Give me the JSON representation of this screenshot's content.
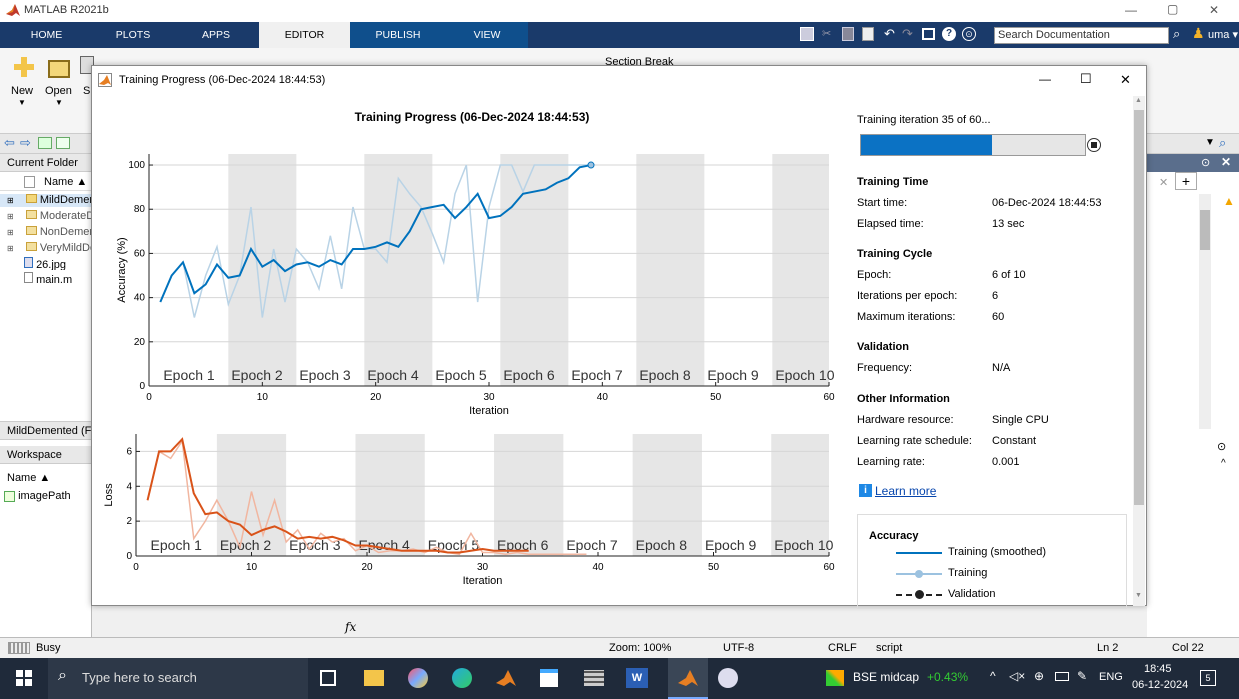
{
  "window": {
    "title": "MATLAB R2021b",
    "min": "—",
    "max": "▢",
    "close": "✕"
  },
  "tabs": [
    "HOME",
    "PLOTS",
    "APPS",
    "EDITOR",
    "PUBLISH",
    "VIEW"
  ],
  "active_tab": "EDITOR",
  "search": {
    "placeholder": "Search Documentation"
  },
  "user": "uma ▾",
  "toolstrip": {
    "new": "New",
    "open": "Open",
    "s": "S",
    "section_break": "Section Break"
  },
  "current_folder": {
    "title": "Current Folder",
    "col": "Name ▲",
    "items": [
      {
        "name": "MildDemented",
        "type": "folder",
        "sel": true
      },
      {
        "name": "ModerateDemented",
        "type": "folder"
      },
      {
        "name": "NonDemented",
        "type": "folder"
      },
      {
        "name": "VeryMildDemented",
        "type": "folder"
      },
      {
        "name": "26.jpg",
        "type": "img"
      },
      {
        "name": "main.m",
        "type": "m"
      }
    ],
    "details": "MildDemented (F"
  },
  "workspace": {
    "title": "Workspace",
    "col": "Name ▲",
    "items": [
      "imagePath"
    ]
  },
  "status": {
    "busy": "Busy",
    "zoom": "Zoom: 100%",
    "enc": "UTF-8",
    "eol": "CRLF",
    "type": "script",
    "ln": "Ln  2",
    "col": "Col  22"
  },
  "command": {
    "fx": "fx"
  },
  "taskbar": {
    "search": "Type here to search",
    "ticker": "BSE midcap",
    "change": "+0.43%",
    "lang": "ENG",
    "time": "18:45",
    "date": "06-12-2024",
    "notif": "5"
  },
  "dialog": {
    "title": "Training Progress (06-Dec-2024 18:44:53)",
    "plot_title": "Training Progress (06-Dec-2024 18:44:53)",
    "min": "—",
    "max": "☐",
    "close": "✕"
  },
  "side": {
    "iteration_text": "Training iteration 35 of 60...",
    "progress": 0.583,
    "training_time": {
      "header": "Training Time",
      "start_label": "Start time:",
      "start": "06-Dec-2024 18:44:53",
      "elapsed_label": "Elapsed time:",
      "elapsed": "13 sec"
    },
    "training_cycle": {
      "header": "Training Cycle",
      "epoch_label": "Epoch:",
      "epoch": "6 of 10",
      "ipe_label": "Iterations per epoch:",
      "ipe": "6",
      "max_label": "Maximum iterations:",
      "max": "60"
    },
    "validation": {
      "header": "Validation",
      "freq_label": "Frequency:",
      "freq": "N/A"
    },
    "other": {
      "header": "Other Information",
      "hw_label": "Hardware resource:",
      "hw": "Single CPU",
      "lrs_label": "Learning rate schedule:",
      "lrs": "Constant",
      "lr_label": "Learning rate:",
      "lr": "0.001"
    },
    "learn_more": "Learn more",
    "legend": {
      "title": "Accuracy",
      "items": [
        "Training (smoothed)",
        "Training",
        "Validation"
      ]
    }
  },
  "chart_data": [
    {
      "type": "line",
      "ylabel": "Accuracy (%)",
      "xlabel": "Iteration",
      "xlim": [
        0,
        60
      ],
      "ylim": [
        0,
        105
      ],
      "xticks": [
        0,
        10,
        20,
        30,
        40,
        50,
        60
      ],
      "yticks": [
        0,
        20,
        40,
        60,
        80,
        100
      ],
      "epochs": [
        "Epoch 1",
        "Epoch 2",
        "Epoch 3",
        "Epoch 4",
        "Epoch 5",
        "Epoch 6",
        "Epoch 7",
        "Epoch 8",
        "Epoch 9",
        "Epoch 10"
      ],
      "series": [
        {
          "name": "Training",
          "x": [
            1,
            2,
            3,
            4,
            5,
            6,
            7,
            8,
            9,
            10,
            11,
            12,
            13,
            14,
            15,
            16,
            17,
            18,
            19,
            20,
            21,
            22,
            23,
            24,
            25,
            26,
            27,
            28,
            29,
            30,
            31,
            32,
            33,
            34,
            35,
            36,
            37,
            38,
            39
          ],
          "values": [
            38,
            50,
            56,
            31,
            50,
            63,
            37,
            50,
            81,
            31,
            62,
            38,
            62,
            56,
            44,
            68,
            44,
            81,
            62,
            62,
            56,
            94,
            87,
            81,
            69,
            56,
            87,
            100,
            38,
            81,
            100,
            100,
            88,
            100,
            100,
            100,
            100,
            100,
            100
          ],
          "color": "#b9d3e6"
        },
        {
          "name": "Training (smoothed)",
          "x": [
            1,
            2,
            3,
            4,
            5,
            6,
            7,
            8,
            9,
            10,
            11,
            12,
            13,
            14,
            15,
            16,
            17,
            18,
            19,
            20,
            21,
            22,
            23,
            24,
            25,
            26,
            27,
            28,
            29,
            30,
            31,
            32,
            33,
            34,
            35,
            36,
            37,
            38,
            39
          ],
          "values": [
            38,
            50,
            56,
            42,
            46,
            55,
            49,
            50,
            62,
            54,
            57,
            52,
            55,
            56,
            54,
            57,
            55,
            62,
            62,
            63,
            65,
            63,
            70,
            80,
            81,
            82,
            76,
            81,
            87,
            76,
            77,
            81,
            87,
            88,
            89,
            92,
            94,
            99,
            100
          ],
          "color": "#0072bd"
        }
      ]
    },
    {
      "type": "line",
      "ylabel": "Loss",
      "xlabel": "Iteration",
      "xlim": [
        0,
        60
      ],
      "ylim": [
        0,
        7
      ],
      "xticks": [
        0,
        10,
        20,
        30,
        40,
        50,
        60
      ],
      "yticks": [
        0,
        2,
        4,
        6
      ],
      "epochs": [
        "Epoch 1",
        "Epoch 2",
        "Epoch 3",
        "Epoch 4",
        "Epoch 5",
        "Epoch 6",
        "Epoch 7",
        "Epoch 8",
        "Epoch 9",
        "Epoch 10"
      ],
      "series": [
        {
          "name": "Training",
          "x": [
            1,
            2,
            3,
            4,
            5,
            6,
            7,
            8,
            9,
            10,
            11,
            12,
            13,
            14,
            15,
            16,
            17,
            18,
            19,
            20,
            21,
            22,
            23,
            24,
            25,
            26,
            27,
            28,
            29,
            30,
            31,
            32,
            33,
            34,
            35,
            36,
            37,
            38,
            39
          ],
          "values": [
            3.2,
            6.0,
            5.6,
            6.6,
            1.0,
            2.0,
            3.2,
            2.0,
            0.5,
            3.7,
            1.2,
            3.2,
            0.8,
            1.5,
            0.4,
            1.3,
            0.8,
            1.0,
            0.3,
            0.6,
            0.2,
            0.3,
            0.3,
            0.4,
            0.2,
            0.5,
            0.2,
            0.1,
            1.3,
            0.2,
            0.2,
            0.1,
            0.2,
            0.1,
            0.1,
            0.1,
            0.1,
            0.1,
            0.1
          ],
          "color": "#f1b6a0"
        },
        {
          "name": "Training (smoothed)",
          "x": [
            1,
            2,
            3,
            4,
            5,
            6,
            7,
            8,
            9,
            10,
            11,
            12,
            13,
            14,
            15,
            16,
            17,
            18,
            19,
            20,
            21,
            22,
            23,
            24,
            25,
            26,
            27,
            28,
            29,
            30,
            31,
            32,
            33,
            34
          ],
          "values": [
            3.2,
            6.0,
            6.0,
            6.7,
            3.6,
            2.4,
            2.5,
            2.0,
            1.8,
            1.2,
            1.5,
            1.7,
            1.4,
            1.0,
            1.1,
            1.0,
            1.1,
            0.9,
            0.6,
            0.6,
            0.5,
            0.4,
            0.3,
            0.3,
            0.3,
            0.3,
            0.2,
            0.2,
            0.3,
            0.4,
            0.3,
            0.3,
            0.3,
            0.3
          ],
          "color": "#d95319"
        }
      ]
    }
  ]
}
